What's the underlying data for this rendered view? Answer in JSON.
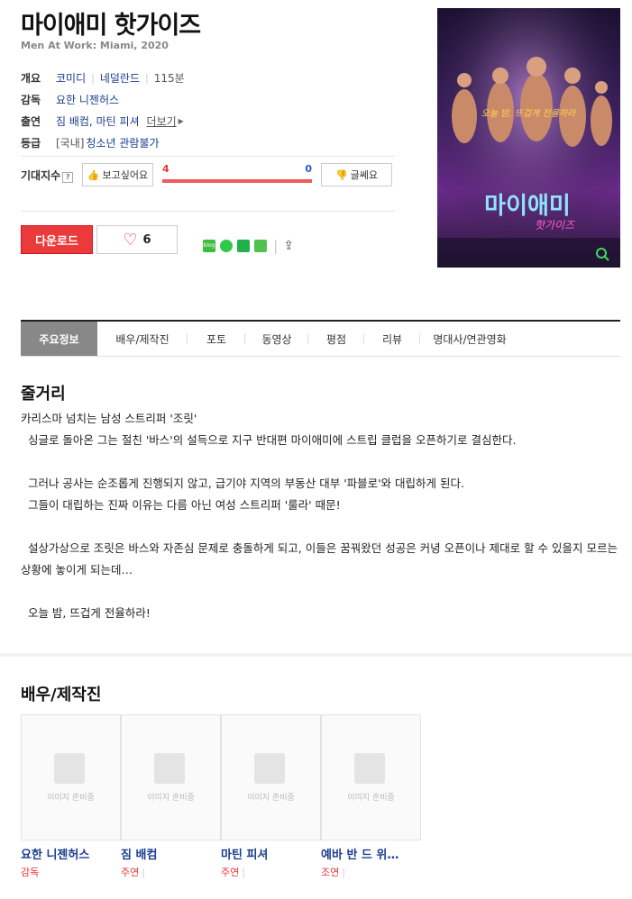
{
  "movie": {
    "title": "마이애미 핫가이즈",
    "original_title": "Men At Work: Miami, 2020"
  },
  "info": {
    "overview_label": "개요",
    "genre": "코미디",
    "country": "네덜란드",
    "runtime": "115분",
    "director_label": "감독",
    "director": "요한 니젠허스",
    "cast_label": "출연",
    "cast": "짐 배컴, 마틴 피셔",
    "more_label": "더보기",
    "rating_label": "등급",
    "rating_prefix": "[국내]",
    "rating": "청소년 관람불가"
  },
  "expectation": {
    "label": "기대지수",
    "want_label": "보고싶어요",
    "want_count": "4",
    "nope_count": "0",
    "nope_label": "글쎄요"
  },
  "actions": {
    "download_label": "다운로드",
    "like_count": "6"
  },
  "tabs": [
    "주요정보",
    "배우/제작진",
    "포토",
    "동영상",
    "평점",
    "리뷰",
    "명대사/연관영화"
  ],
  "plot": {
    "heading": "줄거리",
    "text": "카리스마 넘치는 남성 스트리퍼 '조릿'\n  싱글로 돌아온 그는 절친 '바스'의 설득으로 지구 반대편 마이애미에 스트립 클럽을 오픈하기로 결심한다.\n\n  그러나 공사는 순조롭게 진행되지 않고, 급기야 지역의 부동산 대부 '파블로'와 대립하게 된다.\n  그들이 대립하는 진짜 이유는 다름 아닌 여성 스트리퍼 '룰라' 때문!\n\n  설상가상으로 조릿은 바스와 자존심 문제로 충돌하게 되고, 이들은 꿈꿔왔던 성공은 커녕 오픈이나 제대로 할 수 있을지 모르는 상황에 놓이게 되는데…\n\n  오늘 밤, 뜨겁게 전율하라!"
  },
  "cast_section": {
    "heading": "배우/제작진",
    "placeholder": "이미지 준비중",
    "people": [
      {
        "name": "요한 니젠허스",
        "role": "감독"
      },
      {
        "name": "짐 배컴",
        "role": "주연"
      },
      {
        "name": "마틴 피셔",
        "role": "주연"
      },
      {
        "name": "예바 반 드 위…",
        "role": "조연"
      }
    ]
  },
  "poster": {
    "title": "마이애미",
    "sub": "핫가이즈",
    "tagline": "오늘 밤, 뜨겁게 전율하라"
  }
}
